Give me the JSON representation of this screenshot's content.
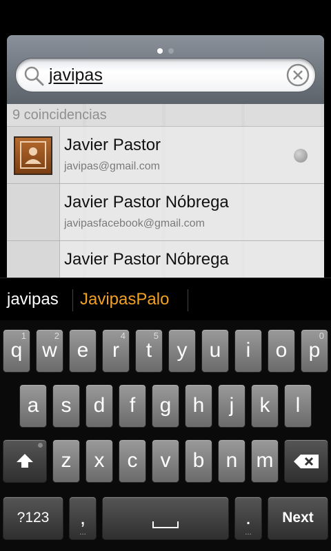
{
  "pager": {
    "pages": 2,
    "active": 0
  },
  "search": {
    "query": "javipas"
  },
  "results": {
    "count_label": "9 coincidencias",
    "items": [
      {
        "name": "Javier Pastor",
        "email": "javipas@gmail.com",
        "has_photo": true
      },
      {
        "name": "Javier Pastor Nóbrega",
        "email": "javipasfacebook@gmail.com",
        "has_photo": false
      },
      {
        "name": "Javier Pastor Nóbrega",
        "email": "",
        "has_photo": false
      }
    ]
  },
  "suggestions": [
    "javipas",
    "JavipasPalo"
  ],
  "keyboard": {
    "row1": [
      "q",
      "w",
      "e",
      "r",
      "t",
      "y",
      "u",
      "i",
      "o",
      "p"
    ],
    "row1_sup": [
      "1",
      "2",
      "",
      "4",
      "5",
      "",
      "",
      "",
      "",
      "0"
    ],
    "row2": [
      "a",
      "s",
      "d",
      "f",
      "g",
      "h",
      "j",
      "k",
      "l"
    ],
    "row3": [
      "z",
      "x",
      "c",
      "v",
      "b",
      "n",
      "m"
    ],
    "symbols_label": "?123",
    "comma_label": ",",
    "period_label": ".",
    "action_label": "Next"
  },
  "colors": {
    "suggestion_accent": "#f2a123"
  }
}
